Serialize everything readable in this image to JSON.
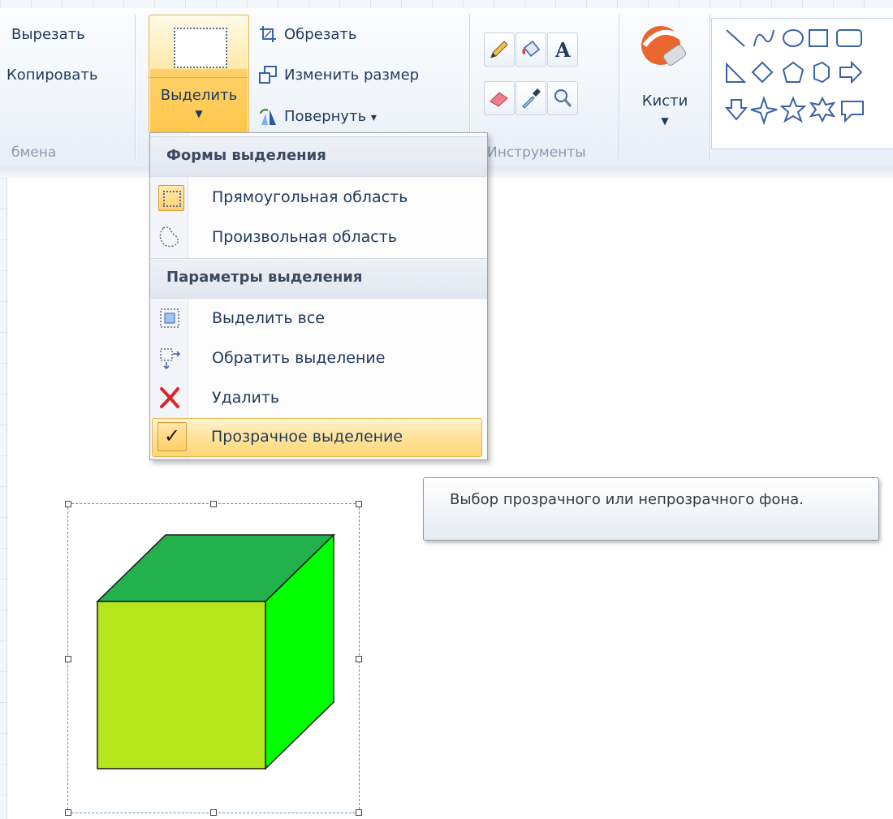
{
  "ribbon": {
    "clipboard": {
      "cut_label": "Вырезать",
      "copy_label": "Копировать",
      "group_title": "бмена"
    },
    "image": {
      "select_label": "Выделить",
      "crop_label": "Обрезать",
      "resize_label": "Изменить размер",
      "rotate_label": "Повернуть",
      "rotate_arrow": "▾"
    },
    "tools": {
      "group_title": "Инструменты"
    },
    "brushes": {
      "label": "Кисти"
    }
  },
  "menu": {
    "sections": [
      {
        "header": "Формы выделения"
      },
      {
        "header": "Параметры выделения"
      }
    ],
    "items": [
      {
        "label": "Прямоугольная область",
        "icon": "rectangle-select-icon",
        "selected": true
      },
      {
        "label": "Произвольная область",
        "icon": "freeform-select-icon"
      },
      {
        "label": "Выделить все",
        "icon": "select-all-icon"
      },
      {
        "label": "Обратить выделение",
        "icon": "invert-selection-icon"
      },
      {
        "label": "Удалить",
        "icon": "delete-icon"
      },
      {
        "label": "Прозрачное выделение",
        "icon": "check-icon",
        "checked": true,
        "check_glyph": "✓"
      }
    ]
  },
  "tooltip": {
    "text": "Выбор прозрачного или непрозрачного фона."
  },
  "canvas": {
    "cube_colors": {
      "front": "#b5e61d",
      "top": "#22b14c",
      "side": "#00ff00"
    },
    "selection_border_color": "#5b8fd1"
  },
  "colors": {
    "highlight": "#ffd778",
    "ribbon_text": "#1e395b"
  }
}
